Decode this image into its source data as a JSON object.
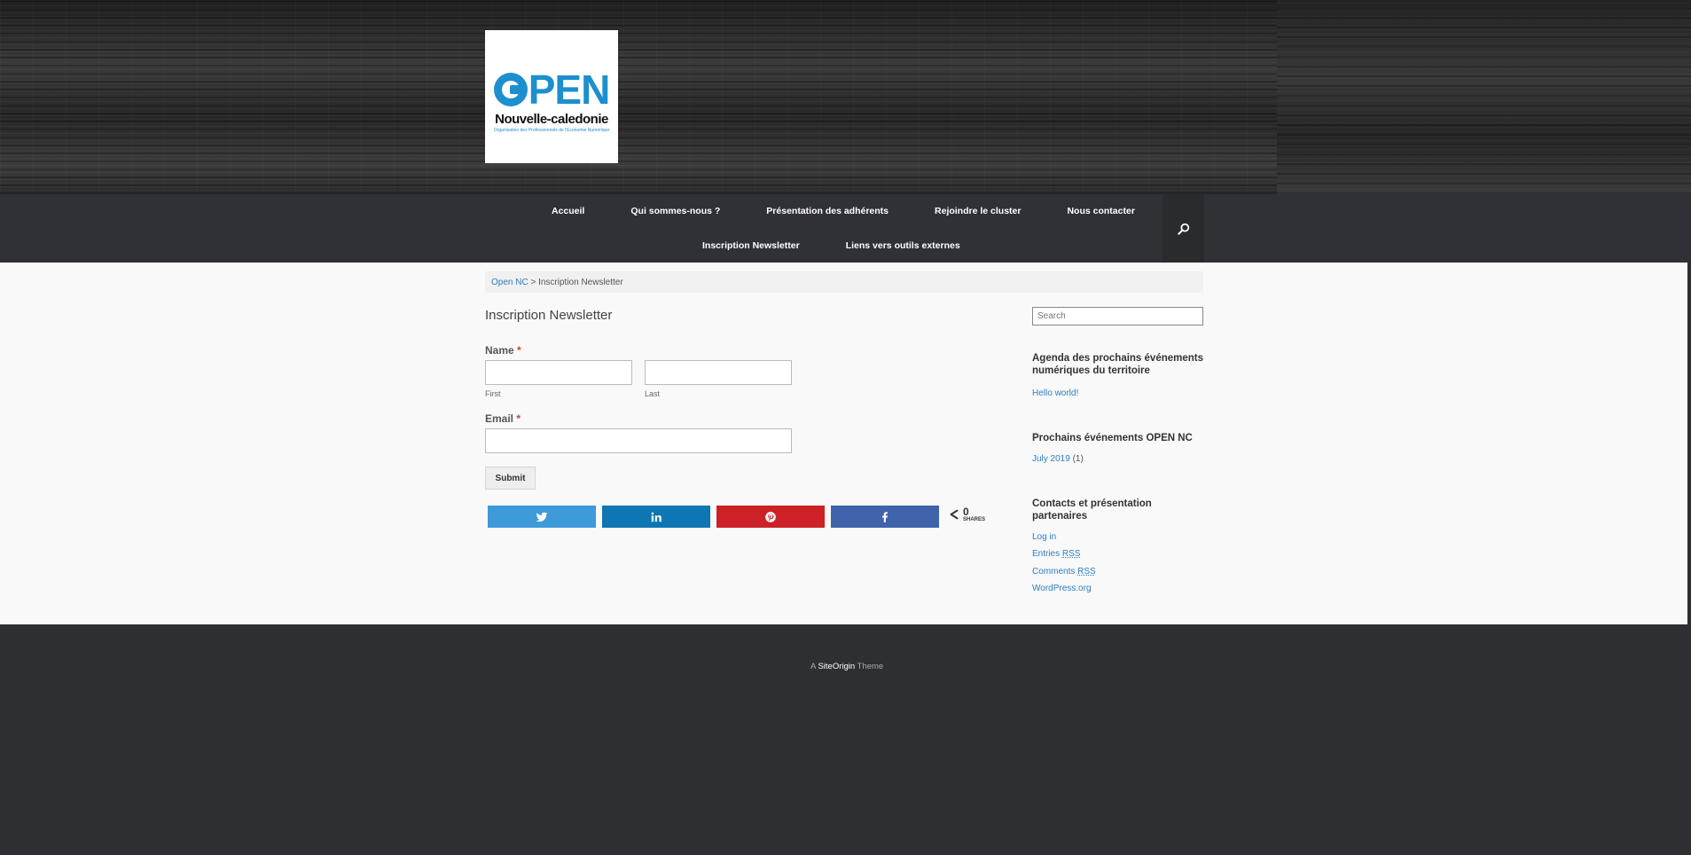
{
  "logo": {
    "main": "PEN",
    "sub": "Nouvelle-caledonie",
    "tagline": "Organisation des Professionnels de l'Economie Numérique"
  },
  "nav": {
    "items": [
      "Accueil",
      "Qui sommes-nous ?",
      "Présentation des adhérents",
      "Rejoindre le cluster",
      "Nous contacter",
      "Inscription Newsletter",
      "Liens vers outils externes"
    ]
  },
  "breadcrumb": {
    "home": "Open NC",
    "separator": " > ",
    "current": "Inscription Newsletter"
  },
  "page": {
    "title": "Inscription Newsletter"
  },
  "form": {
    "name_label": "Name",
    "required_mark": "*",
    "first_value": "",
    "last_value": "",
    "first_sublabel": "First",
    "last_sublabel": "Last",
    "email_label": "Email",
    "email_value": "",
    "submit_label": "Submit"
  },
  "share": {
    "count": "0",
    "count_label": "SHARES",
    "colors": {
      "twitter": "#3e9ad9",
      "linkedin": "#0e76b3",
      "pinterest": "#cc2127",
      "facebook": "#4064ac"
    }
  },
  "sidebar": {
    "search_placeholder": "Search",
    "widget1": {
      "title": "Agenda des prochains événements numériques du territoire",
      "links": [
        "Hello world!"
      ]
    },
    "widget2": {
      "title": "Prochains événements OPEN NC",
      "link": "July 2019",
      "count": "(1)"
    },
    "widget3": {
      "title": "Contacts et présentation partenaires",
      "login": "Log in",
      "entries": "Entries",
      "comments": "Comments",
      "rss": "RSS",
      "wordpress": "WordPress.org"
    }
  },
  "footer": {
    "prefix": "A ",
    "brand": "SiteOrigin",
    "suffix": " Theme"
  }
}
